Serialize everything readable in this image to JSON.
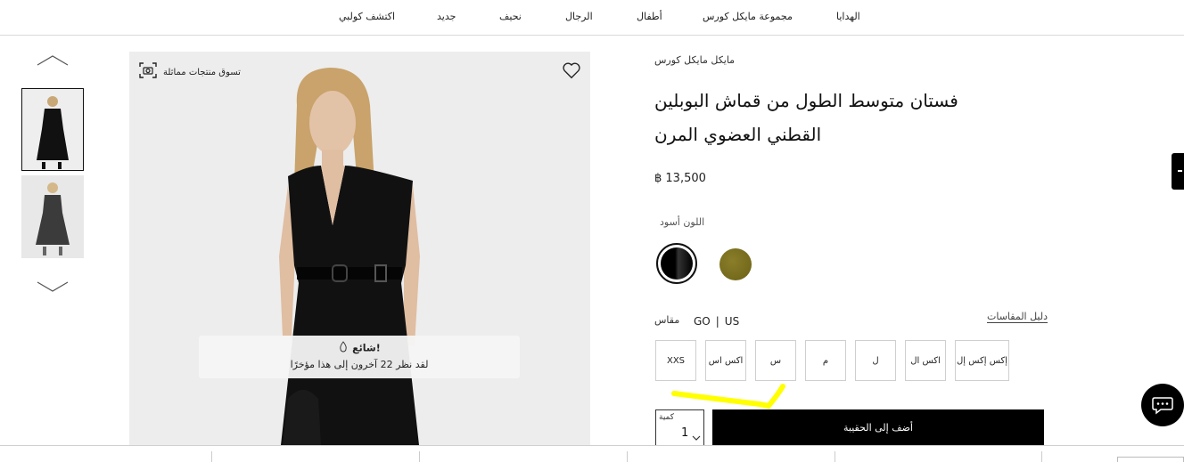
{
  "nav": {
    "items": [
      {
        "label": "الهدايا"
      },
      {
        "label": "مجموعة مايكل كورس"
      },
      {
        "label": "أطفال"
      },
      {
        "label": "الرجال"
      },
      {
        "label": "نحيف"
      },
      {
        "label": "جديد"
      },
      {
        "label": "اكتشف كولبي"
      }
    ]
  },
  "gallery": {
    "shop_similar": "تسوق منتجات مماثلة",
    "trending": {
      "title": "!شائع",
      "subtitle": "لقد نظر 22 آخرون إلى هذا مؤخرًا"
    }
  },
  "product": {
    "brand": "مايكل مايكل كورس",
    "title": "فستان متوسط الطول من قماش البوبلين القطني العضوي المرن",
    "price": "฿ 13,500",
    "color_label": "اللون أسود",
    "colors": [
      {
        "name": "black",
        "hex": "#000000",
        "selected": true
      },
      {
        "name": "olive",
        "hex": "#7a6f1f",
        "selected": false
      }
    ],
    "size_label": "مقاس",
    "size_systems": [
      "GO",
      "|",
      "US"
    ],
    "size_guide": "دليل المقاسات",
    "sizes": [
      "XXS",
      "اكس اس",
      "س",
      "م",
      "ل",
      "اكس ال",
      "إكس إكس إل"
    ],
    "qty_label": "كمية",
    "qty_value": "1",
    "add_to_bag": "أضف إلى الحقيبة"
  },
  "colors": {
    "accent": "#000000",
    "highlight": "#ffff00"
  }
}
